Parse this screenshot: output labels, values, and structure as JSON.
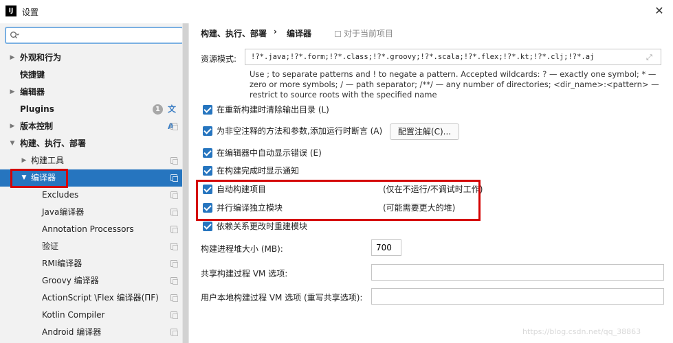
{
  "window": {
    "title": "设置",
    "app_icon": "intellij-icon",
    "app_icon_text": "IJ",
    "close_glyph": "✕"
  },
  "search": {
    "value": "",
    "placeholder": ""
  },
  "sidebar": {
    "items": [
      {
        "label": "外观和行为",
        "arrow": "▶",
        "bold": true
      },
      {
        "label": "快捷键",
        "arrow": "",
        "bold": true
      },
      {
        "label": "编辑器",
        "arrow": "▶",
        "bold": true
      },
      {
        "label": "Plugins",
        "arrow": "",
        "bold": true,
        "badge": "1",
        "extra_icon": "文A"
      },
      {
        "label": "版本控制",
        "arrow": "▶",
        "bold": true
      },
      {
        "label": "构建、执行、部署",
        "arrow": "▼",
        "bold": true
      },
      {
        "label": "构建工具",
        "arrow": "▶",
        "bold": false
      },
      {
        "label": "编译器",
        "arrow": "▼",
        "bold": false,
        "selected": true
      },
      {
        "label": "Excludes",
        "arrow": "",
        "bold": false
      },
      {
        "label": "Java编译器",
        "arrow": "",
        "bold": false
      },
      {
        "label": "Annotation Processors",
        "arrow": "",
        "bold": false
      },
      {
        "label": "验证",
        "arrow": "",
        "bold": false
      },
      {
        "label": "RMI编译器",
        "arrow": "",
        "bold": false
      },
      {
        "label": "Groovy 编译器",
        "arrow": "",
        "bold": false
      },
      {
        "label": "ActionScript \\Flex 编译器(ΠF)",
        "arrow": "",
        "bold": false
      },
      {
        "label": "Kotlin Compiler",
        "arrow": "",
        "bold": false
      },
      {
        "label": "Android 编译器",
        "arrow": "",
        "bold": false
      }
    ]
  },
  "main": {
    "breadcrumb": "构建、执行、部署",
    "breadcrumb_sep": "›",
    "current": "编译器",
    "project_scope": "对于当前项目",
    "resource_label": "资源模式:",
    "resource_value": "!?*.java;!?*.form;!?*.class;!?*.groovy;!?*.scala;!?*.flex;!?*.kt;!?*.clj;!?*.aj",
    "hint_text": "Use ; to separate patterns and ! to negate a pattern. Accepted wildcards: ? — exactly one symbol; * — zero or more symbols; / — path separator; /**/ — any number of directories; <dir_name>:<pattern> — restrict to source roots with the specified name",
    "checkboxes": [
      {
        "label": "在重新构建时清除输出目录 (L)",
        "checked": true,
        "extra": ""
      },
      {
        "label": "为非空注释的方法和参数,添加运行时断言 (A)",
        "checked": true,
        "extra": ""
      },
      {
        "label": "在编辑器中自动显示错误 (E)",
        "checked": true,
        "extra": ""
      },
      {
        "label": "在构建完成时显示通知",
        "checked": true,
        "extra": ""
      },
      {
        "label": "自动构建项目",
        "checked": true,
        "extra": "(仅在不运行/不调试时工作)"
      },
      {
        "label": "并行编译独立模块",
        "checked": true,
        "extra": "(可能需要更大的堆)"
      },
      {
        "label": "依赖关系更改时重建模块",
        "checked": true,
        "extra": ""
      }
    ],
    "annotation_button": "配置注解(C)...",
    "heap_label": "构建进程堆大小 (MB):",
    "heap_value": "700",
    "shared_vm_label": "共享构建过程 VM 选项:",
    "shared_vm_value": "",
    "user_vm_label": "用户本地构建过程 VM 选项 (重写共享选项):",
    "user_vm_value": ""
  },
  "watermark": "https://blog.csdn.net/qq_38863",
  "colors": {
    "selection": "#2675bf",
    "highlight_box": "#d40000",
    "checkbox": "#2675bf"
  }
}
